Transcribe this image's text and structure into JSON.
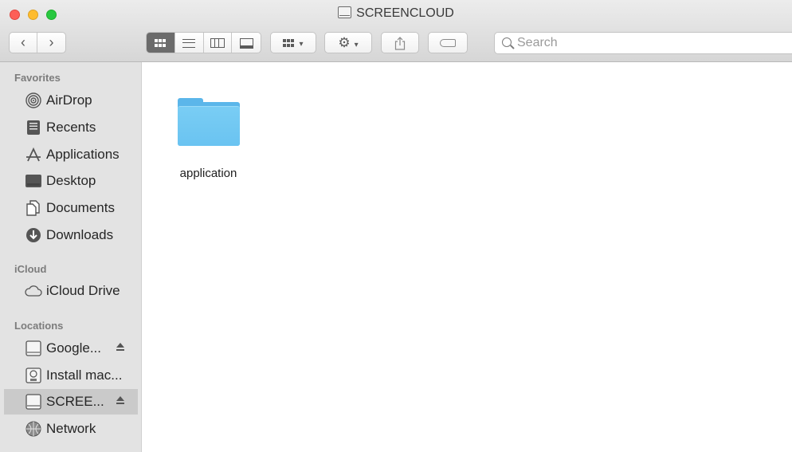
{
  "window": {
    "title": "SCREENCLOUD",
    "title_icon": "external-drive-icon"
  },
  "toolbar": {
    "back_icon": "‹",
    "forward_icon": "›",
    "views": [
      "icon-view",
      "list-view",
      "column-view",
      "gallery-view"
    ],
    "active_view": "icon-view",
    "group_by_icon": "grid-icon",
    "action_icon": "⚙",
    "share_icon": "share-icon",
    "tag_icon": "tag-icon",
    "chevron": "⌄"
  },
  "search": {
    "placeholder": "Search",
    "value": ""
  },
  "sidebar": {
    "favorites_title": "Favorites",
    "icloud_title": "iCloud",
    "locations_title": "Locations",
    "favorites": [
      {
        "label": "AirDrop",
        "icon": "airdrop-icon"
      },
      {
        "label": "Recents",
        "icon": "recents-icon"
      },
      {
        "label": "Applications",
        "icon": "applications-icon"
      },
      {
        "label": "Desktop",
        "icon": "desktop-icon"
      },
      {
        "label": "Documents",
        "icon": "documents-icon"
      },
      {
        "label": "Downloads",
        "icon": "downloads-icon"
      }
    ],
    "icloud": [
      {
        "label": "iCloud Drive",
        "icon": "cloud-icon"
      }
    ],
    "locations": [
      {
        "label": "Google...",
        "icon": "drive-icon",
        "eject": true
      },
      {
        "label": "Install mac...",
        "icon": "disk-image-icon",
        "eject": false
      },
      {
        "label": "SCREE...",
        "icon": "drive-icon",
        "eject": true,
        "selected": true
      },
      {
        "label": "Network",
        "icon": "network-icon",
        "eject": false
      }
    ]
  },
  "content": {
    "items": [
      {
        "name": "application",
        "kind": "folder"
      }
    ]
  },
  "colors": {
    "sidebar_bg": "#e3e3e3",
    "selected_bg": "#cacaca",
    "folder_blue": "#6ac3f1",
    "close": "#fd5f57",
    "minimize": "#febc2e",
    "zoom": "#28c840"
  }
}
